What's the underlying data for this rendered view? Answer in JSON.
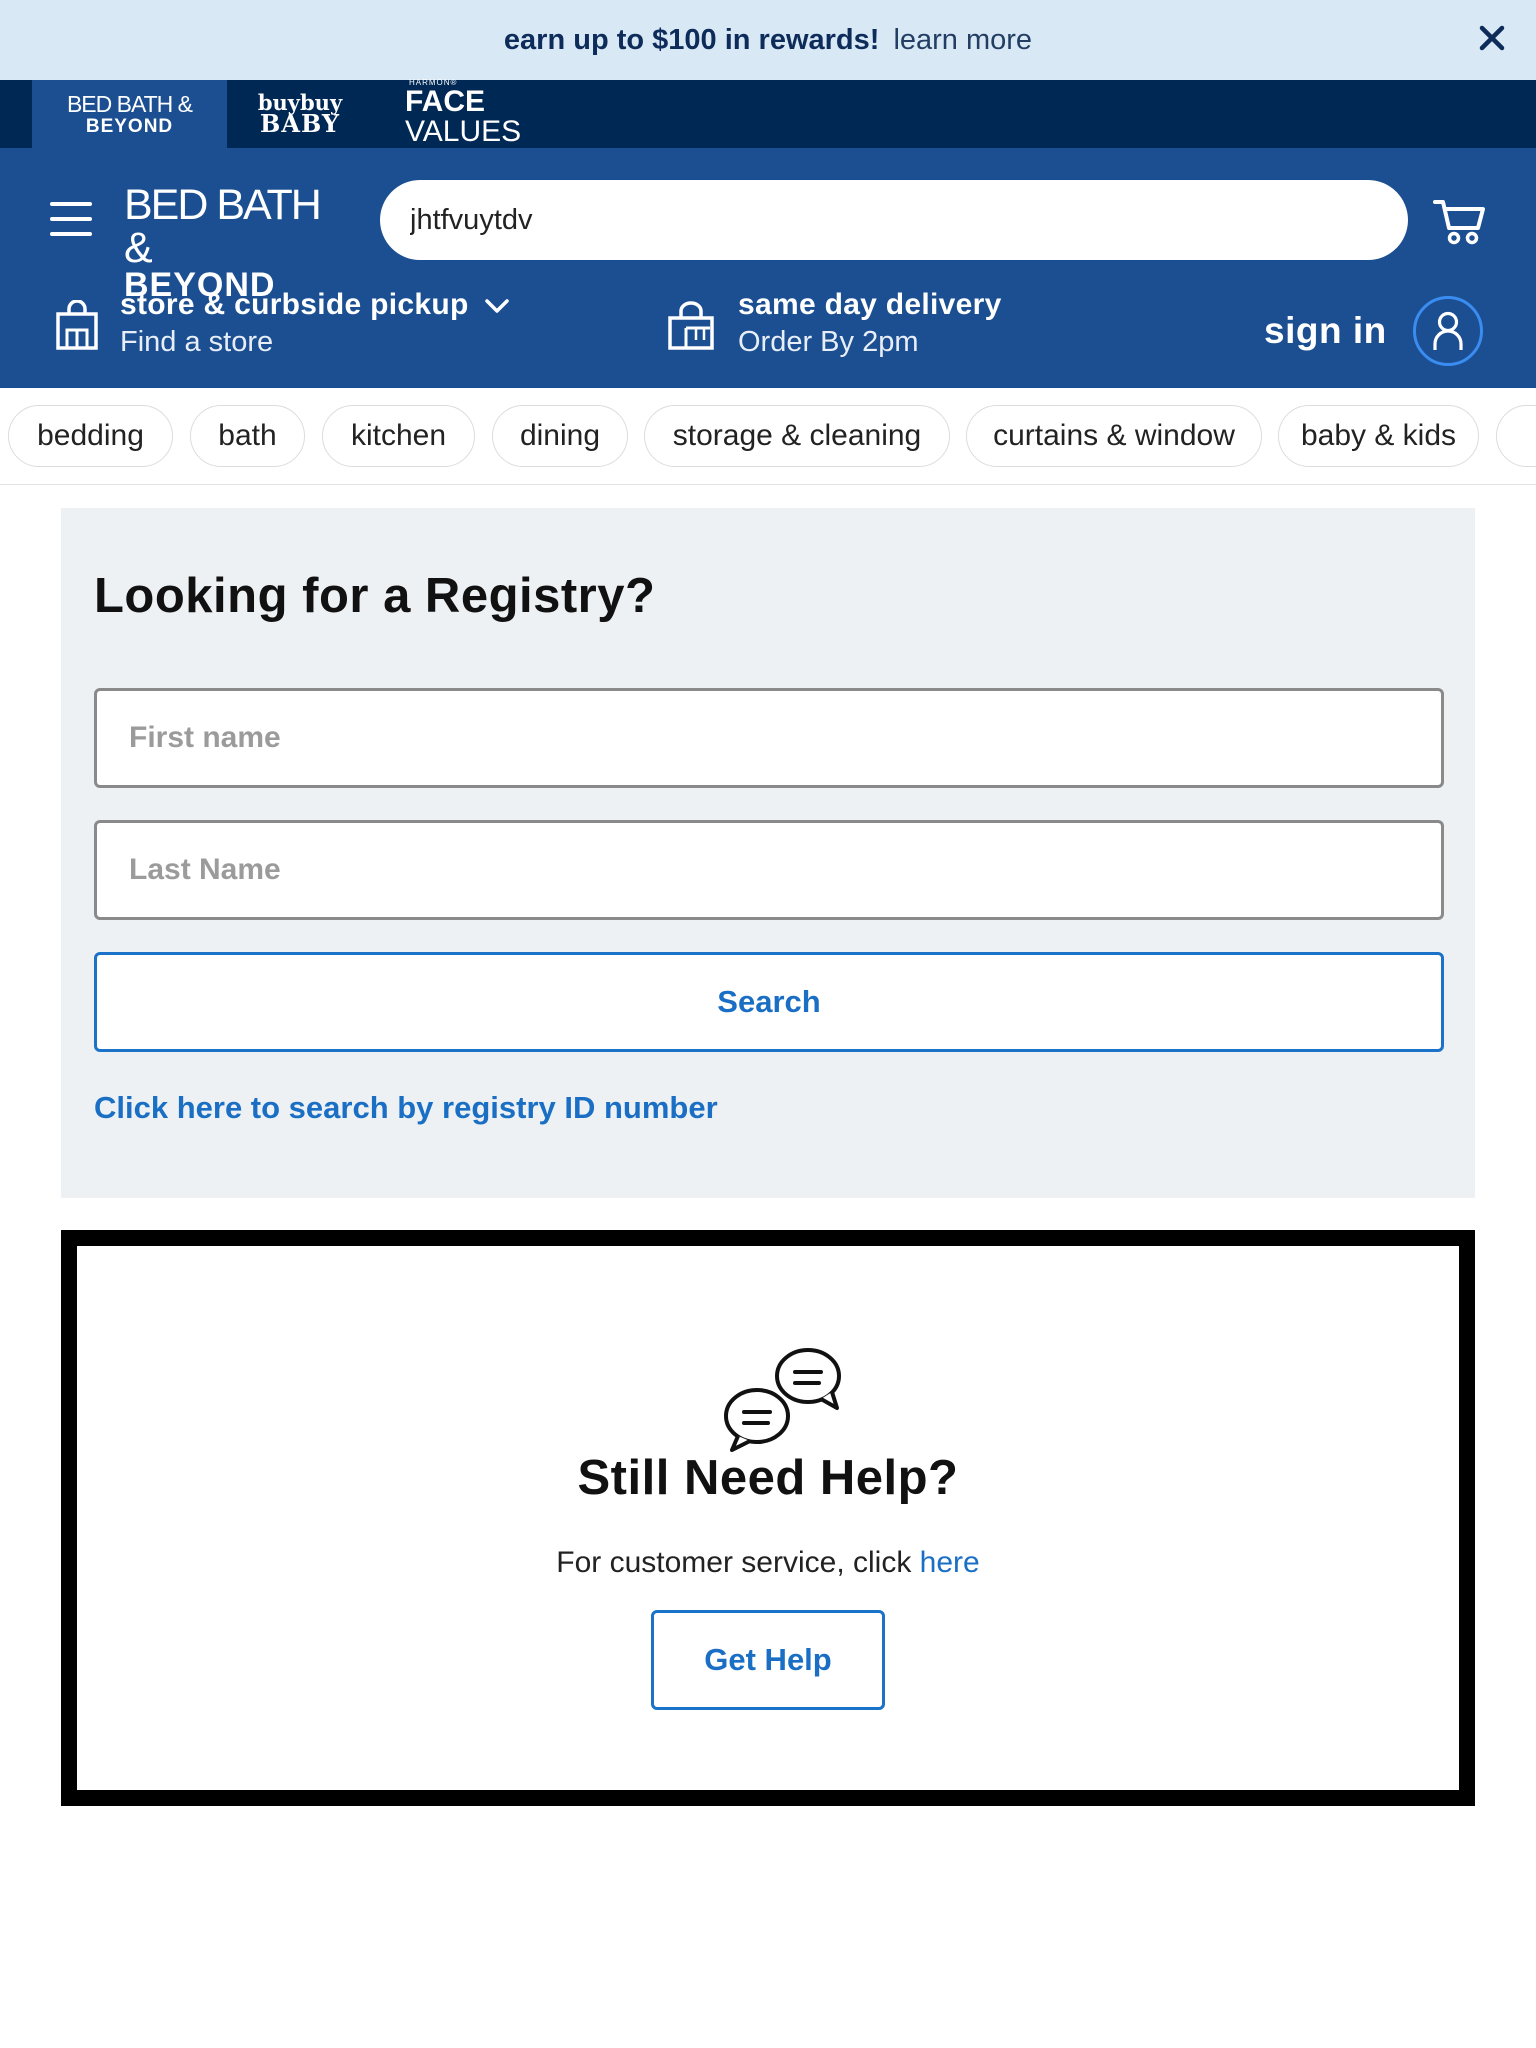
{
  "promo": {
    "bold_text": "earn up to $100 in rewards!",
    "link_text": "learn more"
  },
  "brands": {
    "bbb_line1": "BED BATH &",
    "bbb_line2": "BEYOND",
    "baby_line1": "buybuy",
    "baby_line2": "BABY",
    "fv_top": "HARMON®",
    "fv_face": "FACE",
    "fv_values": " VALUES"
  },
  "header": {
    "logo_line1": "BED BATH &",
    "logo_line2": "BEYOND",
    "search_value": "jhtfvuytdv",
    "pickup_title": "store & curbside pickup",
    "pickup_sub": "Find a store",
    "sameday_title": "same day delivery",
    "sameday_sub": "Order By 2pm",
    "signin": "sign in"
  },
  "categories": [
    "bedding",
    "bath",
    "kitchen",
    "dining",
    "storage & cleaning",
    "curtains & window",
    "baby & kids"
  ],
  "registry": {
    "title": "Looking for a Registry?",
    "first_name_placeholder": "First name",
    "last_name_placeholder": "Last Name",
    "search_button": "Search",
    "id_link": "Click here to search by registry ID number"
  },
  "help": {
    "title": "Still Need Help?",
    "text": "For customer service, click ",
    "link": "here",
    "button": "Get Help"
  },
  "colors": {
    "header_blue": "#1b4f91",
    "brand_navy": "#002855",
    "promo_bg": "#d9e8f5",
    "link_blue": "#1a6fc4",
    "card_bg": "#edf1f3"
  },
  "icons": [
    "close-icon",
    "menu-icon",
    "cart-icon",
    "store-bag-icon",
    "chevron-down-icon",
    "delivery-box-icon",
    "user-icon",
    "chat-bubbles-icon"
  ]
}
